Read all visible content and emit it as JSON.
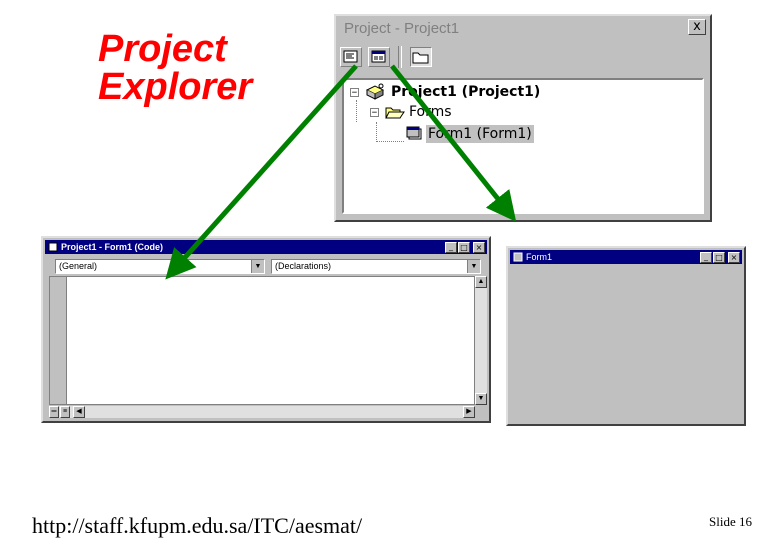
{
  "slide": {
    "title_line1": "Project",
    "title_line2": "Explorer",
    "url": "http://staff.kfupm.edu.sa/ITC/aesmat/",
    "slide_number": "Slide 16",
    "title_color": "#ff0000",
    "arrow_color": "#008000"
  },
  "project_window": {
    "title": "Project - Project1",
    "close_glyph": "x",
    "toolbar": {
      "view_code_icon": "view-code-icon",
      "view_object_icon": "view-object-icon",
      "toggle_folders_icon": "folder-icon"
    },
    "tree": {
      "root": {
        "expander": "−",
        "label": "Project1 (Project1)"
      },
      "folder": {
        "expander": "−",
        "label": "Forms"
      },
      "item": {
        "label": "Form1 (Form1)"
      }
    }
  },
  "code_window": {
    "title": "Project1 - Form1 (Code)",
    "object_combo": "(General)",
    "procedure_combo": "(Declarations)"
  },
  "form_window": {
    "title": "Form1"
  }
}
